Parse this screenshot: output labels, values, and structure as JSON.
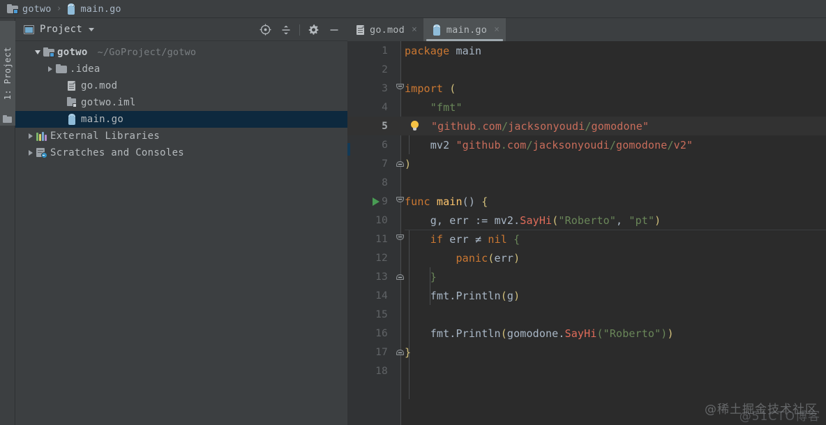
{
  "breadcrumb": {
    "project_name": "gotwo",
    "separator": "›",
    "file_name": "main.go",
    "project_icon": "module-folder-icon",
    "file_icon": "go-file-icon"
  },
  "tool_strip": {
    "project_button_label": "1: Project",
    "project_button_icon": "folder-icon"
  },
  "project_panel": {
    "title": "Project",
    "title_icon": "project-window-icon",
    "dropdown_icon": "chevron-down-icon",
    "actions": [
      {
        "name": "locate-in-tree",
        "icon": "crosshair-target-icon"
      },
      {
        "name": "collapse-all",
        "icon": "collapse-all-icon"
      },
      {
        "name": "settings",
        "icon": "gear-icon"
      },
      {
        "name": "hide-panel",
        "icon": "minimize-icon"
      }
    ],
    "tree": [
      {
        "label": "gotwo",
        "path_hint": "~/GoProject/gotwo",
        "icon": "module-folder-icon",
        "twisty": "expanded",
        "depth": 0,
        "bold": true,
        "selected": false
      },
      {
        "label": ".idea",
        "path_hint": "",
        "icon": "folder-icon",
        "twisty": "collapsed",
        "depth": 1,
        "bold": false,
        "selected": false
      },
      {
        "label": "go.mod",
        "path_hint": "",
        "icon": "mod-file-icon",
        "twisty": "none",
        "depth": 2,
        "bold": false,
        "selected": false
      },
      {
        "label": "gotwo.iml",
        "path_hint": "",
        "icon": "iml-file-icon",
        "twisty": "none",
        "depth": 2,
        "bold": false,
        "selected": false
      },
      {
        "label": "main.go",
        "path_hint": "",
        "icon": "go-file-icon",
        "twisty": "none",
        "depth": 2,
        "bold": false,
        "selected": true
      },
      {
        "label": "External Libraries",
        "path_hint": "",
        "icon": "library-books-icon",
        "twisty": "collapsed",
        "depth": 0,
        "bold": false,
        "selected": false
      },
      {
        "label": "Scratches and Consoles",
        "path_hint": "",
        "icon": "scratches-clock-icon",
        "twisty": "collapsed",
        "depth": 0,
        "bold": false,
        "selected": false
      }
    ]
  },
  "editor": {
    "tabs": [
      {
        "label": "go.mod",
        "icon": "mod-file-icon",
        "active": false,
        "close_glyph": "×"
      },
      {
        "label": "main.go",
        "icon": "go-file-icon",
        "active": true,
        "close_glyph": "×"
      }
    ],
    "current_line": 5,
    "run_marker_line": 9,
    "bulb_line": 5,
    "lines": [
      {
        "n": "1",
        "text": "package main"
      },
      {
        "n": "2",
        "text": ""
      },
      {
        "n": "3",
        "text": "import ("
      },
      {
        "n": "4",
        "text": "    \"fmt\""
      },
      {
        "n": "5",
        "text": "    \"github.com/jacksonyoudi/gomodone\""
      },
      {
        "n": "6",
        "text": "    mv2 \"github.com/jacksonyoudi/gomodone/v2\""
      },
      {
        "n": "7",
        "text": ")"
      },
      {
        "n": "8",
        "text": ""
      },
      {
        "n": "9",
        "text": "func main() {"
      },
      {
        "n": "10",
        "text": "    g, err := mv2.SayHi(\"Roberto\", \"pt\")"
      },
      {
        "n": "11",
        "text": "    if err ≠ nil {"
      },
      {
        "n": "12",
        "text": "        panic(err)"
      },
      {
        "n": "13",
        "text": "    }"
      },
      {
        "n": "14",
        "text": "    fmt.Println(g)"
      },
      {
        "n": "15",
        "text": ""
      },
      {
        "n": "16",
        "text": "    fmt.Println(gomodone.SayHi(\"Roberto\"))"
      },
      {
        "n": "17",
        "text": "}"
      },
      {
        "n": "18",
        "text": ""
      }
    ]
  },
  "watermarks": {
    "juejin": "@稀土掘金技术社区",
    "cto": "@51CTO博客"
  },
  "colors": {
    "panel_bg": "#3c3f41",
    "editor_bg": "#2b2b2b",
    "gutter_bg": "#313335",
    "selection_bg": "#0d293e",
    "current_line_bg": "#323232",
    "keyword": "#cc7832",
    "string": "#6a8759",
    "function": "#ffc66d",
    "identifier": "#a9b7c6",
    "method_red": "#e06c5a",
    "run_green": "#499c54",
    "bulb_yellow": "#f5c144"
  }
}
